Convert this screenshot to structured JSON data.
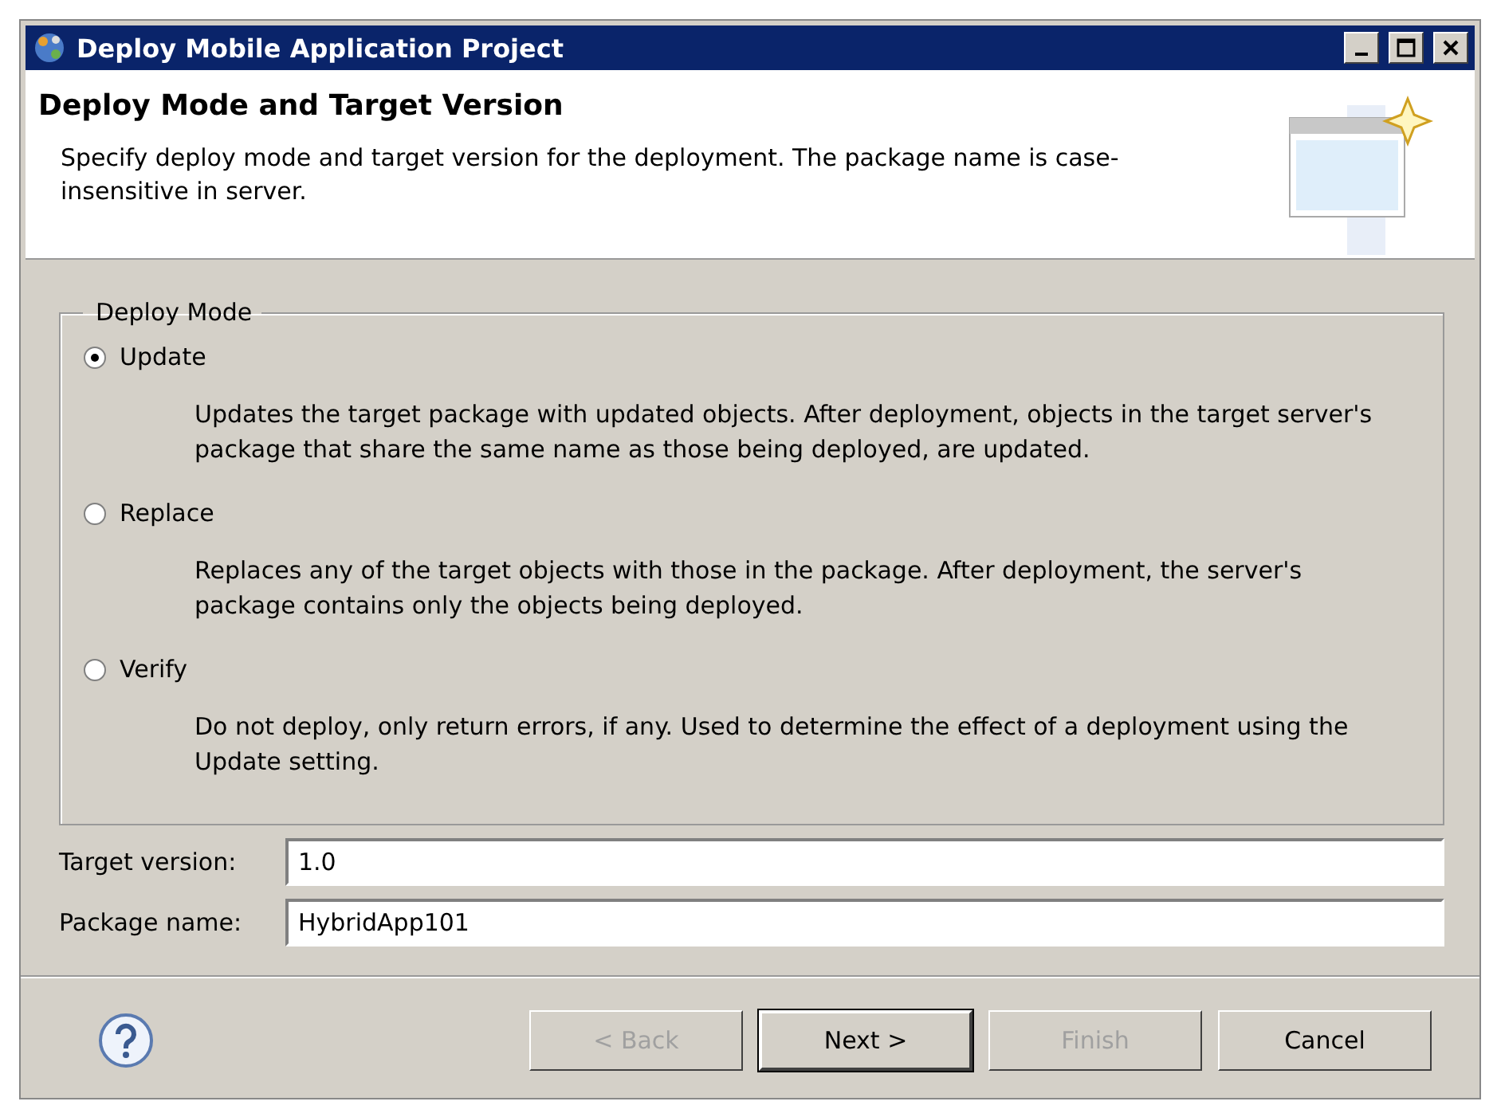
{
  "window": {
    "title": "Deploy Mobile Application Project"
  },
  "header": {
    "title": "Deploy Mode and Target Version",
    "description": "Specify deploy mode and target version for the deployment. The package name is case-insensitive in server."
  },
  "deploy_mode": {
    "legend": "Deploy Mode",
    "options": [
      {
        "label": "Update",
        "selected": true,
        "description": "Updates the target package with updated objects. After deployment, objects in the target server's package that share the same name as those being deployed, are updated."
      },
      {
        "label": "Replace",
        "selected": false,
        "description": "Replaces any of the target objects with those in the package. After deployment, the server's package contains only the objects being deployed."
      },
      {
        "label": "Verify",
        "selected": false,
        "description": "Do not deploy, only return errors, if any. Used to determine the effect of a deployment using the Update setting."
      }
    ]
  },
  "fields": [
    {
      "label": "Target version:",
      "value": "1.0"
    },
    {
      "label": "Package name:",
      "value": "HybridApp101"
    }
  ],
  "buttons": [
    {
      "label": "< Back",
      "disabled": true,
      "default": false
    },
    {
      "label": "Next >",
      "disabled": false,
      "default": true
    },
    {
      "label": "Finish",
      "disabled": true,
      "default": false
    },
    {
      "label": "Cancel",
      "disabled": false,
      "default": false
    }
  ]
}
